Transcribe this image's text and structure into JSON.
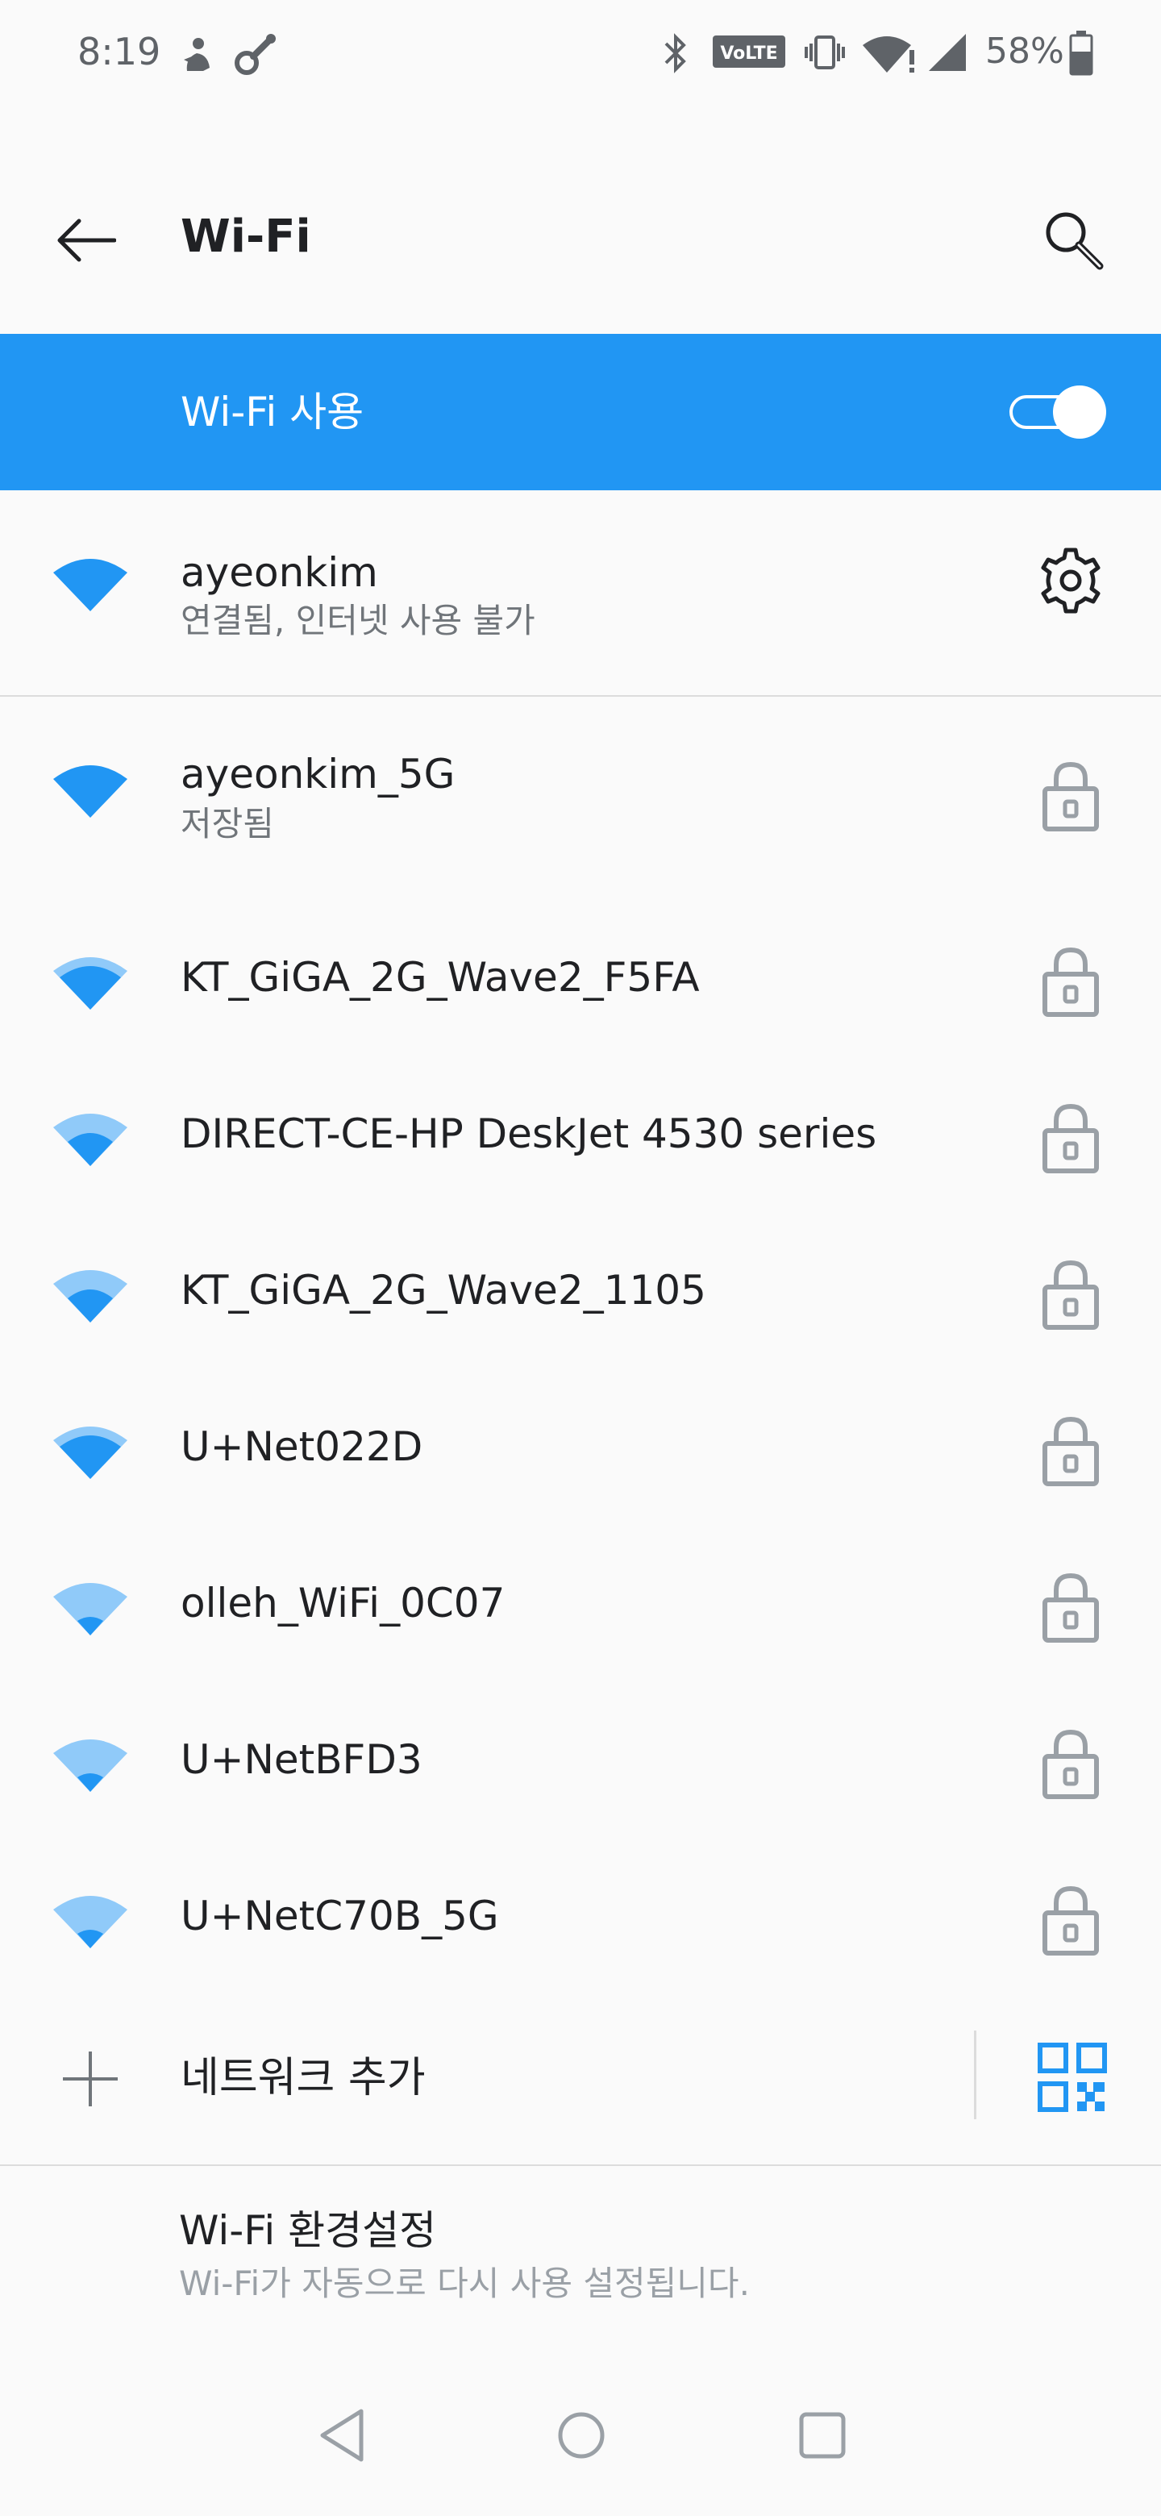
{
  "status_bar": {
    "time": "8:19",
    "battery_percent": "58%",
    "icons": [
      "notification-app-icon",
      "notification-tool-icon",
      "bluetooth-icon",
      "volte-icon",
      "vibrate-icon",
      "wifi-no-internet-icon",
      "cell-signal-icon",
      "battery-icon"
    ],
    "volte_label": "VoLTE"
  },
  "app_bar": {
    "title": "Wi-Fi",
    "back_icon": "arrow-back-icon",
    "search_icon": "search-icon"
  },
  "wifi_master": {
    "label": "Wi-Fi 사용",
    "enabled": true,
    "accent_color": "#2196f3"
  },
  "connected_network": {
    "name": "ayeonkim",
    "status": "연결됨, 인터넷 사용 불가",
    "signal_level": 4,
    "icon": "gear-icon"
  },
  "networks": [
    {
      "name": "ayeonkim_5G",
      "status": "저장됨",
      "signal_level": 4,
      "secured": true
    },
    {
      "name": "KT_GiGA_2G_Wave2_F5FA",
      "status": "",
      "signal_level": 3,
      "secured": true
    },
    {
      "name": "DIRECT-CE-HP DeskJet 4530 series",
      "status": "",
      "signal_level": 2,
      "secured": true
    },
    {
      "name": "KT_GiGA_2G_Wave2_1105",
      "status": "",
      "signal_level": 2,
      "secured": true
    },
    {
      "name": "U+Net022D",
      "status": "",
      "signal_level": 3,
      "secured": true
    },
    {
      "name": "olleh_WiFi_0C07",
      "status": "",
      "signal_level": 1,
      "secured": true
    },
    {
      "name": "U+NetBFD3",
      "status": "",
      "signal_level": 1,
      "secured": true
    },
    {
      "name": "U+NetC70B_5G",
      "status": "",
      "signal_level": 1,
      "secured": true
    }
  ],
  "add_network": {
    "label": "네트워크 추가",
    "icon": "plus-icon",
    "qr_icon": "qr-code-icon"
  },
  "preferences": {
    "title": "Wi-Fi 환경설정",
    "subtitle": "Wi-Fi가 자동으로 다시 사용 설정됩니다."
  },
  "nav_bar": {
    "icons": [
      "nav-back-icon",
      "nav-home-icon",
      "nav-recents-icon"
    ]
  }
}
